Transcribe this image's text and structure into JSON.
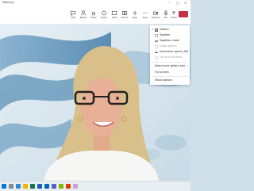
{
  "window": {
    "title": "Meeting"
  },
  "toolbar": {
    "items": [
      {
        "label": "Chat",
        "icon": "chat-icon"
      },
      {
        "label": "People",
        "icon": "people-icon"
      },
      {
        "label": "Raise",
        "icon": "raise-hand-icon"
      },
      {
        "label": "React",
        "icon": "react-icon"
      },
      {
        "label": "View",
        "icon": "view-icon"
      },
      {
        "label": "Rooms",
        "icon": "rooms-icon"
      },
      {
        "label": "Apps",
        "icon": "apps-icon"
      },
      {
        "label": "More",
        "icon": "more-icon"
      },
      {
        "label": "Camera",
        "icon": "camera-icon"
      },
      {
        "label": "Mic",
        "icon": "mic-icon"
      },
      {
        "label": "Share",
        "icon": "share-icon"
      }
    ],
    "leave_color": "#c4314b"
  },
  "view_menu": {
    "items": [
      {
        "label": "Gallery",
        "checked": true,
        "icon": "gallery-icon",
        "dim": false
      },
      {
        "label": "Speaker",
        "checked": false,
        "icon": "speaker-icon",
        "dim": false
      },
      {
        "label": "Together mode",
        "checked": false,
        "icon": "together-mode-icon",
        "dim": false
      },
      {
        "label": "Large gallery",
        "checked": false,
        "icon": "large-gallery-icon",
        "dim": true
      },
      {
        "label": "Immersive space (3D)",
        "checked": false,
        "icon": "immersive-space-icon",
        "dim": false
      },
      {
        "label": "Focus on content",
        "checked": false,
        "icon": "focus-icon",
        "dim": true
      },
      {
        "label": "Select max gallery size",
        "checked": false,
        "icon": "",
        "dim": false,
        "arrow": true
      },
      {
        "label": "Full screen",
        "checked": false,
        "icon": "full-screen-icon",
        "dim": false
      },
      {
        "label": "Show options",
        "checked": false,
        "icon": "",
        "dim": false
      }
    ]
  },
  "colors": {
    "accent": "#5b5fc7",
    "leave": "#c4314b"
  }
}
